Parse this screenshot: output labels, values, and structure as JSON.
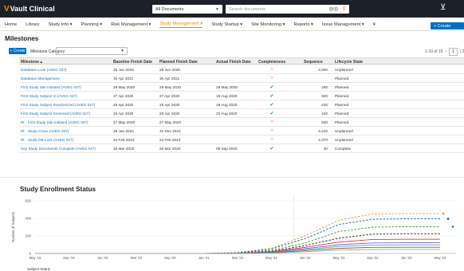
{
  "app": {
    "logo": "Vault Clinical",
    "cart_icon": "cart-icon"
  },
  "scope": {
    "value": "All Documents"
  },
  "search": {
    "placeholder": "Search documents"
  },
  "nav": {
    "items": [
      {
        "label": "Home"
      },
      {
        "label": "Library"
      },
      {
        "label": "Study Info ▾"
      },
      {
        "label": "Planning ▾"
      },
      {
        "label": "Risk Management ▾"
      },
      {
        "label": "Study Management ▾",
        "active": true
      },
      {
        "label": "Study Startup ▾"
      },
      {
        "label": "Site Monitoring ▾"
      },
      {
        "label": "Reports ▾"
      },
      {
        "label": "Issue Management ▾"
      },
      {
        "label": "¥"
      }
    ],
    "create_label": "+ Create"
  },
  "milestones": {
    "title": "Milestones",
    "create_label": "+ Create",
    "category_label": "Milestone Category",
    "pager_text": "1-10 of 15",
    "pager_page": "1",
    "pager_total": "/ 2",
    "columns": [
      "Milestone ▴",
      "Baseline Finish Date",
      "Planned Finish Date",
      "Actual Finish Date",
      "Completeness",
      "Sequence",
      "Lifecycle State"
    ],
    "rows": [
      {
        "name": "Database Lock (AVEG 027)",
        "baseline": "25 Jun 2025",
        "planned": "25 Jun 2025",
        "actual": "",
        "complete": false,
        "sequence": "2,500",
        "state": "Unplanned"
      },
      {
        "name": "Database Management",
        "baseline": "30 Apr 2021",
        "planned": "30 Apr 2021",
        "actual": "",
        "complete": false,
        "sequence": "",
        "state": "Planned"
      },
      {
        "name": "First Study Site Initiated (AVEG 027)",
        "baseline": "29 May 2020",
        "planned": "29 May 2020",
        "actual": "29 May 2020",
        "complete": true,
        "sequence": "490",
        "state": "Planned"
      },
      {
        "name": "First Study Subject In (AVEG 027)",
        "baseline": "27 Apr 2020",
        "planned": "27 Apr 2020",
        "actual": "19 Aug 2020",
        "complete": true,
        "sequence": "500",
        "state": "Planned"
      },
      {
        "name": "First Study Subject Randomized (AVEG 027)",
        "baseline": "25 Apr 2020",
        "planned": "25 Apr 2020",
        "actual": "19 Aug 2020",
        "complete": true,
        "sequence": "430",
        "state": "Planned"
      },
      {
        "name": "First Study Subject Screened (AVEG 027)",
        "baseline": "20 Apr 2020",
        "planned": "20 Apr 2020",
        "actual": "21 Aug 2020",
        "complete": true,
        "sequence": "440",
        "state": "Planned"
      },
      {
        "name": "IR - First Study Site Initiated (AVEG 027)",
        "baseline": "27 May 2020",
        "planned": "27 May 2020",
        "actual": "",
        "complete": false,
        "sequence": "540",
        "state": "Planned"
      },
      {
        "name": "IR - Study Close (AVEG 027)",
        "baseline": "28 Jan 2024",
        "planned": "31 Dec 2023",
        "actual": "",
        "complete": false,
        "sequence": "2,410",
        "state": "Unplanned"
      },
      {
        "name": "IR - Study DB Lock (AVEG 027)",
        "baseline": "24 Feb 2023",
        "planned": "24 Feb 2023",
        "actual": "",
        "complete": false,
        "sequence": "2,370",
        "state": "Unplanned"
      },
      {
        "name": "Key Study Documents Complete (AVEG 027)",
        "baseline": "20 Mar 2020",
        "planned": "20 Mar 2020",
        "actual": "09 Sep 2020",
        "complete": true,
        "sequence": "40",
        "state": "Complete"
      }
    ]
  },
  "enrollment": {
    "title": "Study Enrollment Status",
    "legend_title": "Subject Status"
  },
  "chart_data": {
    "type": "line",
    "ylabel": "Number of Subjects",
    "ylim": [
      0,
      600
    ],
    "yticks": [
      0,
      200,
      400,
      600
    ],
    "x": [
      "May '19",
      "Sep '19",
      "Jan '20",
      "Mar '20",
      "Sep '20",
      "Jan '21",
      "Mar '21",
      "May '21",
      "Jan '22",
      "May '22",
      "Sep '22",
      "Jan '23",
      "May '23"
    ],
    "series": [
      {
        "color": "#f59b42",
        "dashed": true,
        "values": [
          0,
          0,
          0,
          0,
          0,
          0,
          10,
          60,
          200,
          380,
          450,
          455,
          455
        ]
      },
      {
        "color": "#1f6fbf",
        "dashed": true,
        "values": [
          0,
          0,
          0,
          0,
          0,
          0,
          8,
          50,
          170,
          330,
          390,
          395,
          395
        ]
      },
      {
        "color": "#3aa63a",
        "dashed": true,
        "values": [
          0,
          0,
          0,
          0,
          0,
          0,
          5,
          35,
          120,
          250,
          300,
          305,
          305
        ]
      },
      {
        "color": "#333333",
        "dashed": true,
        "values": [
          0,
          0,
          0,
          0,
          0,
          0,
          4,
          25,
          90,
          175,
          220,
          225,
          225
        ]
      },
      {
        "color": "#d73b3b",
        "dashed": false,
        "values": [
          0,
          0,
          0,
          0,
          0,
          0,
          3,
          20,
          70,
          130,
          160,
          162,
          162
        ]
      },
      {
        "color": "#8e5bd0",
        "dashed": false,
        "values": [
          0,
          0,
          0,
          0,
          0,
          0,
          2,
          15,
          55,
          100,
          120,
          122,
          122
        ]
      },
      {
        "color": "#2db3c9",
        "dashed": false,
        "values": [
          0,
          0,
          0,
          0,
          0,
          0,
          2,
          12,
          45,
          80,
          96,
          98,
          98
        ]
      },
      {
        "color": "#8b5a2b",
        "dashed": false,
        "values": [
          0,
          0,
          0,
          0,
          0,
          0,
          1,
          8,
          32,
          58,
          70,
          71,
          71
        ]
      },
      {
        "color": "#9aa1a8",
        "dashed": false,
        "values": [
          0,
          0,
          0,
          0,
          0,
          0,
          1,
          5,
          20,
          38,
          45,
          46,
          46
        ]
      }
    ]
  }
}
